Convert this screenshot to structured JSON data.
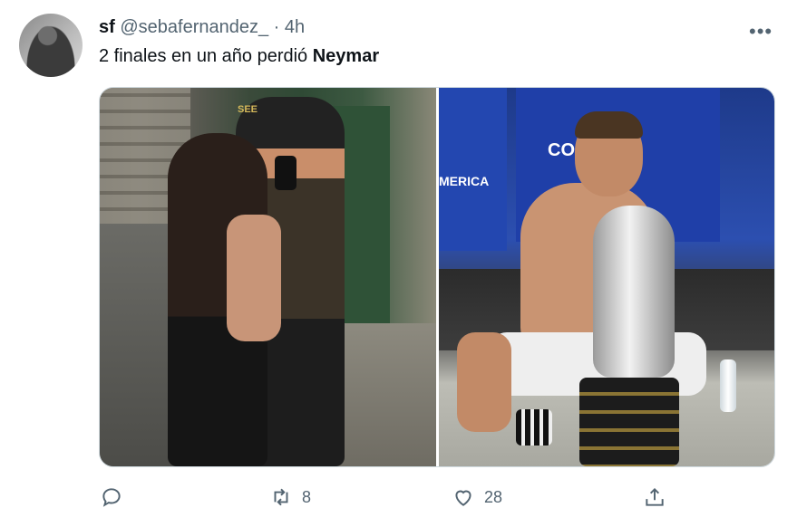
{
  "tweet": {
    "display_name": "sf",
    "handle": "@sebafernandez_",
    "separator": "·",
    "time": "4h",
    "more_label": "•••",
    "text_prefix": "2 finales en un año perdió ",
    "text_bold": "Neymar"
  },
  "media": {
    "right_banner_text": "CONTE.",
    "right_side_text": "MERICA",
    "left_cap_text": "SEE"
  },
  "actions": {
    "reply_count": "",
    "retweet_count": "8",
    "like_count": "28"
  },
  "icons": [
    "reply-icon",
    "retweet-icon",
    "like-icon",
    "share-icon",
    "more-icon"
  ],
  "colors": {
    "text": "#0f1419",
    "secondary": "#536471",
    "border": "#cfd9de"
  }
}
